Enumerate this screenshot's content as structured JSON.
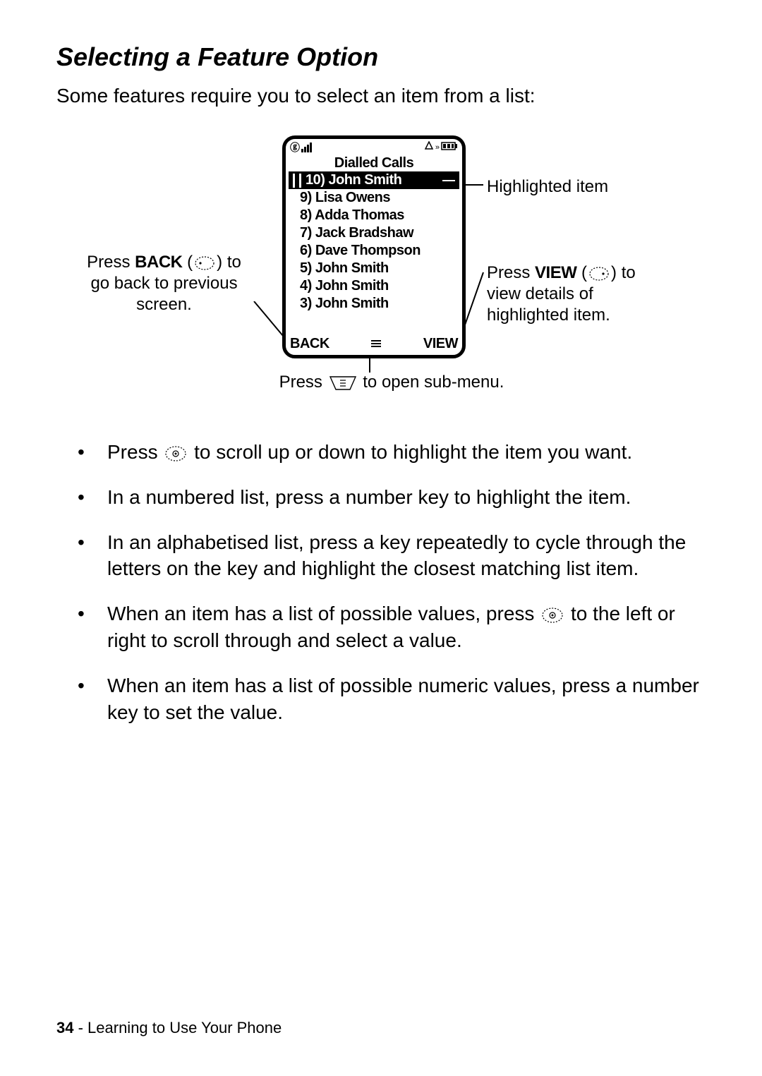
{
  "title": "Selecting a Feature Option",
  "intro": "Some features require you to select an item from a list:",
  "phone": {
    "screen_title": "Dialled Calls",
    "list": [
      {
        "n": "10)",
        "name": "John Smith",
        "hl": true
      },
      {
        "n": "9)",
        "name": "Lisa Owens"
      },
      {
        "n": "8)",
        "name": "Adda Thomas"
      },
      {
        "n": "7)",
        "name": "Jack Bradshaw"
      },
      {
        "n": "6)",
        "name": "Dave Thompson"
      },
      {
        "n": "5)",
        "name": "John Smith"
      },
      {
        "n": "4)",
        "name": "John Smith"
      },
      {
        "n": "3)",
        "name": "John Smith"
      }
    ],
    "soft_left": "BACK",
    "soft_right": "VIEW"
  },
  "callouts": {
    "left_pre": "Press ",
    "left_bold": "BACK",
    "left_post": " (",
    "left_tail": ") to go back to previous screen.",
    "hl": "Highlighted item",
    "view_pre": "Press ",
    "view_bold": "VIEW",
    "view_post": " (",
    "view_tail": ") to view details of highlighted item.",
    "sub_pre": "Press ",
    "sub_post": " to open sub-menu."
  },
  "bullets": {
    "b1_pre": "Press ",
    "b1_post": " to scroll up or down to highlight the item you want.",
    "b2": "In a numbered list, press a number key to highlight the item.",
    "b3": "In an alphabetised list, press a key repeatedly to cycle through the letters on the key and highlight the closest matching list item.",
    "b4_pre": "When an item has a list of possible values, press ",
    "b4_post": " to the left or right to scroll through and select a value.",
    "b5": "When an item has a list of possible numeric values, press a number key to set the value."
  },
  "footer": {
    "page": "34",
    "section": " - Learning to Use Your Phone"
  }
}
